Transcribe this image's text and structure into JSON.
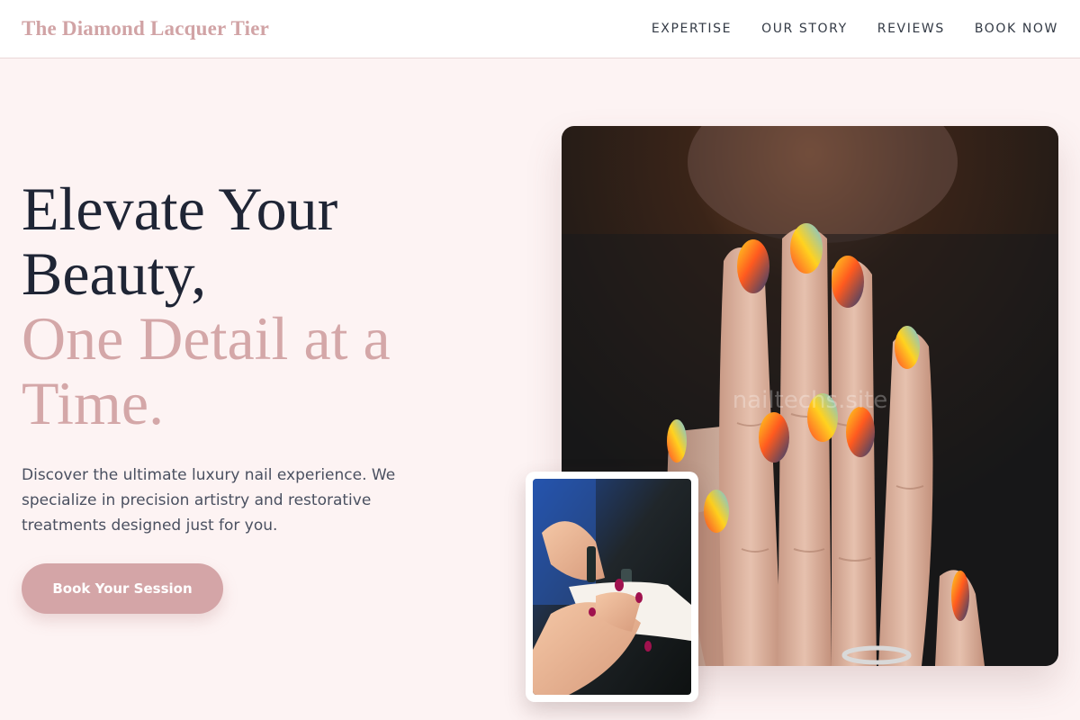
{
  "header": {
    "brand": "The Diamond Lacquer Tier",
    "nav": [
      "EXPERTISE",
      "OUR STORY",
      "REVIEWS",
      "BOOK NOW"
    ]
  },
  "hero": {
    "headline_line1": "Elevate Your",
    "headline_line2": "Beauty,",
    "headline_accent_line1": "One Detail at a",
    "headline_accent_line2": "Time.",
    "description": "Discover the ultimate luxury nail experience. We specialize in precision artistry and restorative treatments designed just for you.",
    "cta_label": "Book Your Session"
  },
  "images": {
    "main_watermark": "nailtechs.site"
  },
  "colors": {
    "background": "#fdf3f3",
    "brand_pink": "#d4a5a7",
    "headline_dark": "#1f2535",
    "body_text": "#4a5060"
  }
}
